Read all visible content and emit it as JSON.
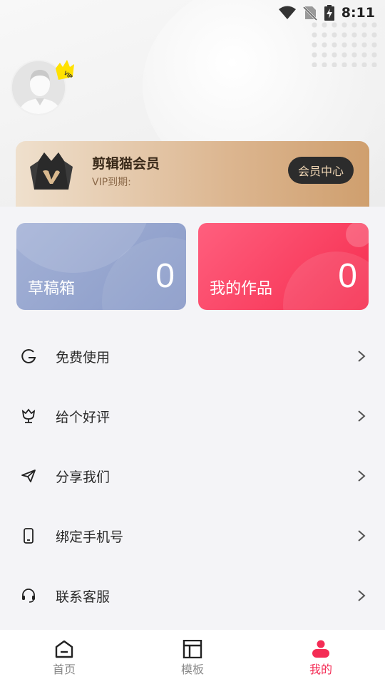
{
  "status_bar": {
    "time": "8:11"
  },
  "profile": {
    "avatar_icon": "avatar-placeholder-icon",
    "vip_badge": "VIP"
  },
  "vip_card": {
    "title": "剪辑猫会员",
    "expiry_label": "VIP到期:",
    "center_button": "会员中心"
  },
  "stats": [
    {
      "label": "草稿箱",
      "count": "0"
    },
    {
      "label": "我的作品",
      "count": "0"
    }
  ],
  "menu": [
    {
      "label": "免费使用",
      "icon": "g-letter-icon"
    },
    {
      "label": "给个好评",
      "icon": "tulip-icon"
    },
    {
      "label": "分享我们",
      "icon": "paper-plane-icon"
    },
    {
      "label": "绑定手机号",
      "icon": "phone-icon"
    },
    {
      "label": "联系客服",
      "icon": "headset-icon"
    }
  ],
  "tabs": [
    {
      "label": "首页",
      "icon": "home-icon"
    },
    {
      "label": "模板",
      "icon": "template-icon"
    },
    {
      "label": "我的",
      "icon": "person-icon"
    }
  ],
  "colors": {
    "accent": "#f42c55",
    "vip_gold": "#dcb690",
    "drafts_blue": "#8a9bc8"
  }
}
